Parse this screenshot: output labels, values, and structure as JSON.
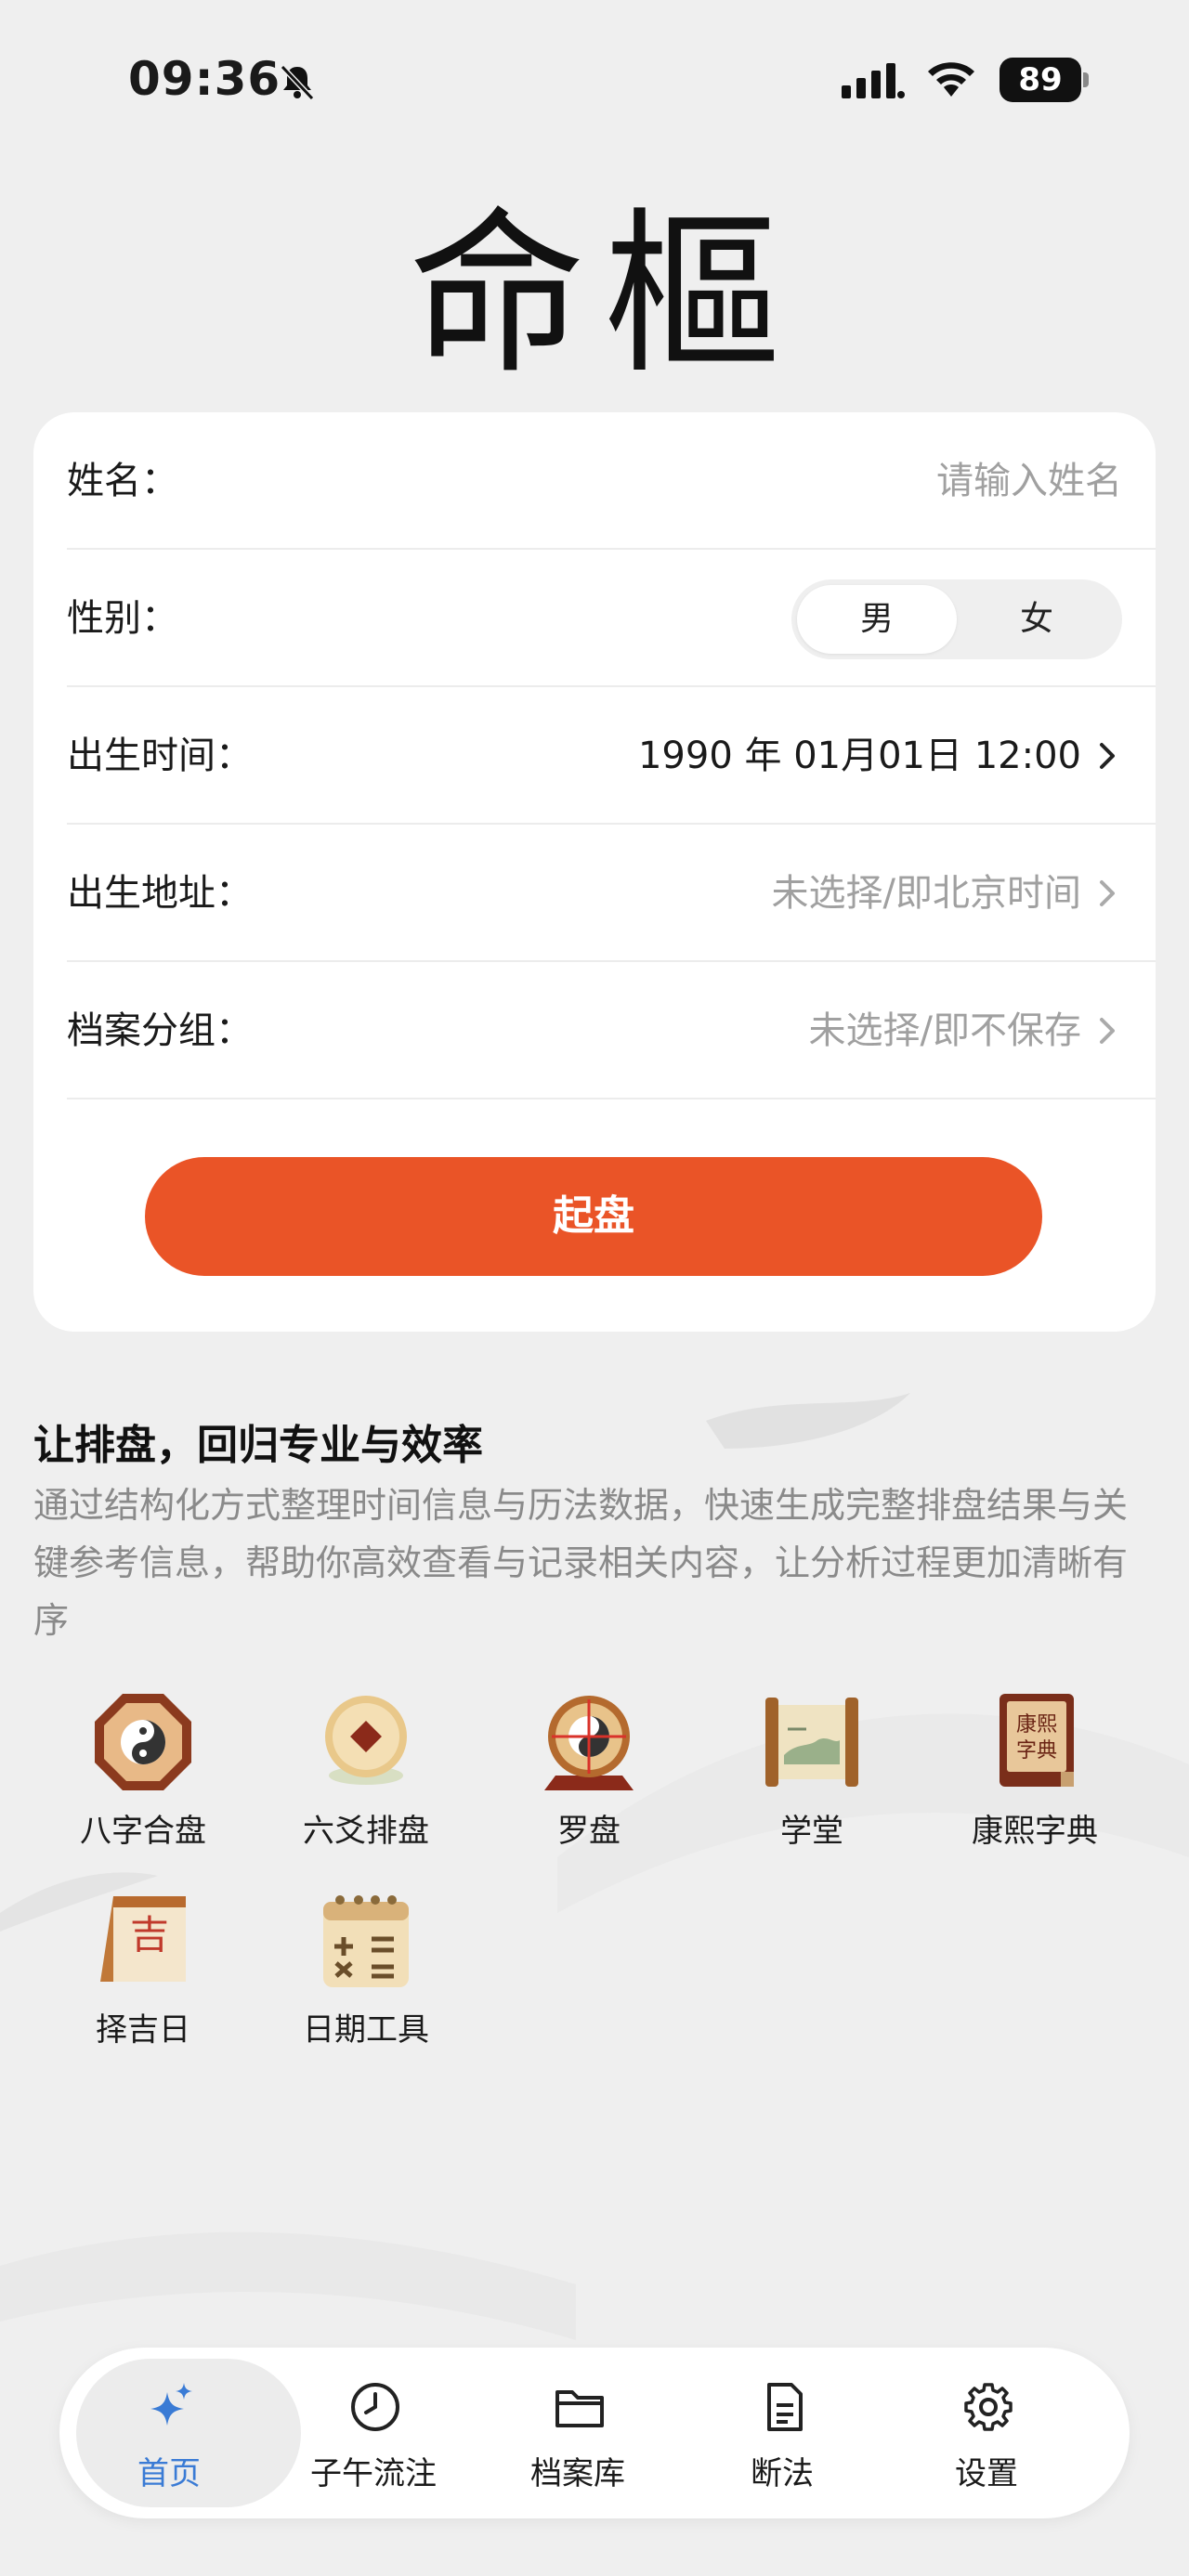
{
  "status_bar": {
    "time": "09:36",
    "battery": "89"
  },
  "logo": {
    "char1": "命",
    "char2": "樞"
  },
  "form": {
    "name": {
      "label": "姓名：",
      "placeholder": "请输入姓名"
    },
    "gender": {
      "label": "性别：",
      "options": [
        "男",
        "女"
      ],
      "selected": "男"
    },
    "birth_time": {
      "label": "出生时间：",
      "value": "1990 年 01月01日 12:00"
    },
    "birth_place": {
      "label": "出生地址：",
      "value": "未选择/即北京时间"
    },
    "group": {
      "label": "档案分组：",
      "value": "未选择/即不保存"
    },
    "submit_label": "起盘"
  },
  "intro": {
    "title": "让排盘，回归专业与效率",
    "description": "通过结构化方式整理时间信息与历法数据，快速生成完整排盘结果与关键参考信息，帮助你高效查看与记录相关内容，让分析过程更加清晰有序"
  },
  "tools": [
    {
      "label": "八字合盘",
      "icon": "bagua-icon"
    },
    {
      "label": "六爻排盘",
      "icon": "coin-icon"
    },
    {
      "label": "罗盘",
      "icon": "compass-icon"
    },
    {
      "label": "学堂",
      "icon": "scroll-icon"
    },
    {
      "label": "康熙字典",
      "icon": "dictionary-icon",
      "icon_text": "康熙字典"
    },
    {
      "label": "择吉日",
      "icon": "calendar-icon",
      "icon_text": "吉"
    },
    {
      "label": "日期工具",
      "icon": "calculator-icon"
    }
  ],
  "nav": [
    {
      "label": "首页",
      "icon": "sparkle-icon",
      "active": true
    },
    {
      "label": "子午流注",
      "icon": "clock-icon",
      "active": false
    },
    {
      "label": "档案库",
      "icon": "folder-icon",
      "active": false
    },
    {
      "label": "断法",
      "icon": "document-icon",
      "active": false
    },
    {
      "label": "设置",
      "icon": "gear-icon",
      "active": false
    }
  ],
  "colors": {
    "accent": "#ea5427",
    "nav_active": "#3a7bd5",
    "background": "#efefef",
    "card": "#ffffff",
    "placeholder": "#a0a0a0"
  }
}
